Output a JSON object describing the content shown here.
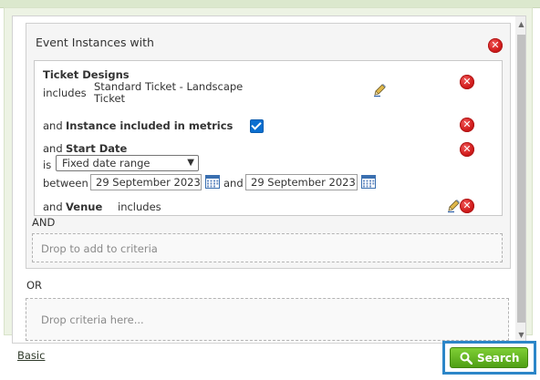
{
  "event_box": {
    "title": "Event Instances with"
  },
  "criteria": {
    "ticket_designs": {
      "label": "Ticket Designs",
      "operator": "includes",
      "value_line1": "Standard Ticket - Landscape",
      "value_line2": "Ticket"
    },
    "instance_metrics": {
      "prefix": "and",
      "label": "Instance included in metrics",
      "checked": true
    },
    "start_date": {
      "prefix": "and",
      "label": "Start Date",
      "is_label": "is",
      "selected_option": "Fixed date range",
      "between_label": "between",
      "date_from": "29 September 2023",
      "and_label": "and",
      "date_to": "29 September 2023"
    },
    "venue": {
      "prefix": "and",
      "label": "Venue",
      "operator": "includes"
    }
  },
  "and_label": "AND",
  "drop_add_criteria": "Drop to add to criteria",
  "or_label": "OR",
  "drop_criteria_here": "Drop criteria here...",
  "footer": {
    "basic_link": "Basic",
    "search_button": "Search"
  },
  "icons": {
    "remove": "remove-icon",
    "edit": "pencil-icon",
    "calendar": "calendar-icon",
    "search": "magnifier-icon"
  },
  "colors": {
    "remove_red": "#d31d1d",
    "search_green": "#5fb320",
    "highlight_blue": "#2c86c8",
    "checkbox_blue": "#0b6fd0"
  }
}
